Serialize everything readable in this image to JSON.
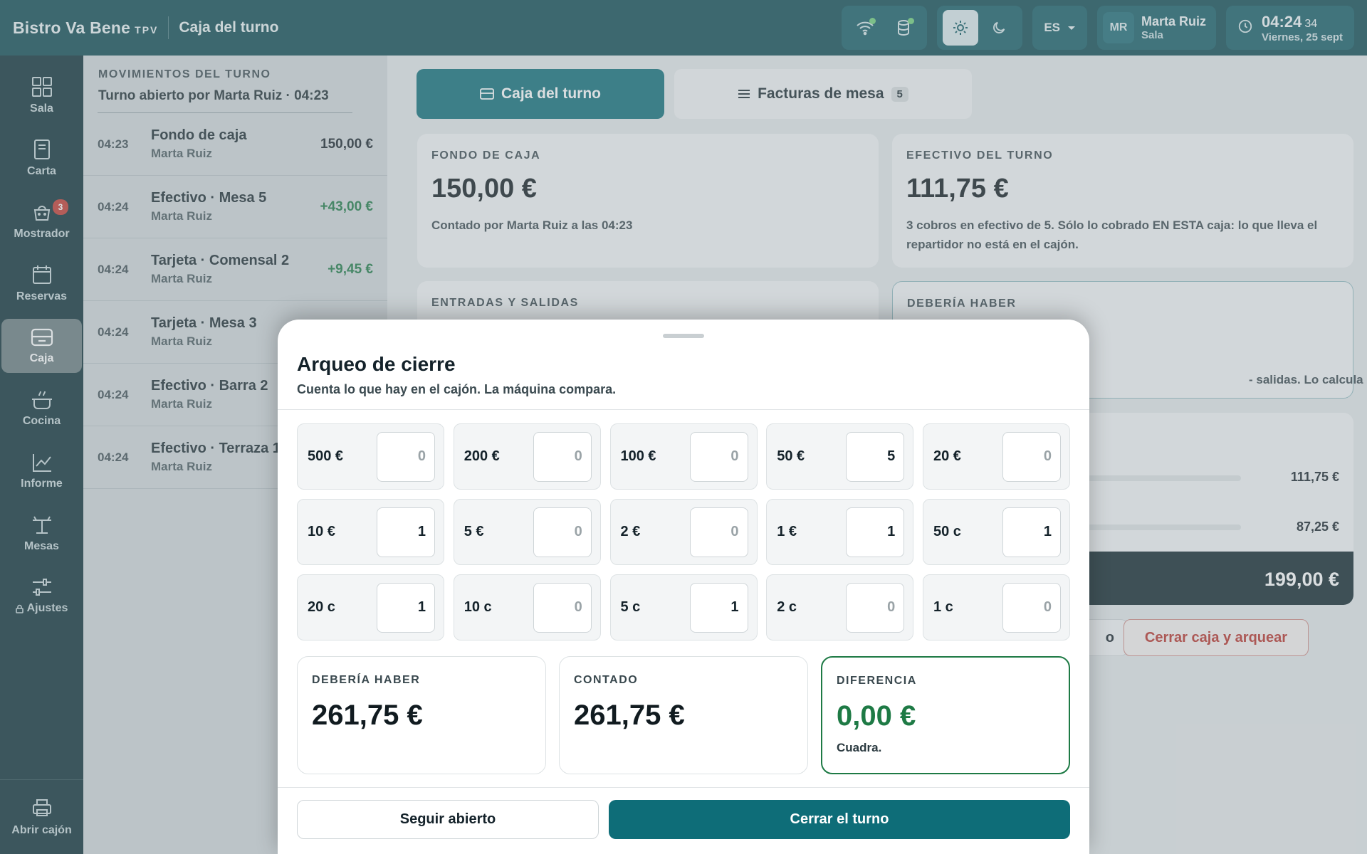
{
  "header": {
    "brand": "Bistro Va Bene",
    "brand_tag": "TPV",
    "screen_title": "Caja del turno",
    "lang": "ES",
    "user_initials": "MR",
    "user_name": "Marta Ruiz",
    "user_role": "Sala",
    "time": "04:24",
    "seconds": "34",
    "date": "Viernes, 25 sept",
    "icons": [
      "wifi-icon",
      "database-icon",
      "sun-icon",
      "moon-icon",
      "clock-icon"
    ],
    "status_color": "#6fd07a"
  },
  "sidebar": {
    "items": [
      {
        "label": "Sala",
        "icon": "grid-icon"
      },
      {
        "label": "Carta",
        "icon": "book-icon"
      },
      {
        "label": "Mostrador",
        "icon": "basket-icon",
        "badge": "3"
      },
      {
        "label": "Reservas",
        "icon": "calendar-icon"
      },
      {
        "label": "Caja",
        "icon": "register-icon",
        "active": true
      },
      {
        "label": "Cocina",
        "icon": "pot-icon"
      },
      {
        "label": "Informe",
        "icon": "chart-icon"
      },
      {
        "label": "Mesas",
        "icon": "table-icon"
      },
      {
        "label": "Ajustes",
        "icon": "sliders-icon",
        "locked": true
      }
    ],
    "drawer": "Abrir cajón"
  },
  "moves": {
    "title": "MOVIMIENTOS DEL TURNO",
    "subtitle": "Turno abierto por Marta Ruiz · 04:23",
    "rows": [
      {
        "time": "04:23",
        "label": "Fondo de caja",
        "who": "Marta Ruiz",
        "amount": "150,00 €"
      },
      {
        "time": "04:24",
        "label": "Efectivo · Mesa 5",
        "who": "Marta Ruiz",
        "amount": "+43,00 €"
      },
      {
        "time": "04:24",
        "label": "Tarjeta · Comensal 2",
        "who": "Marta Ruiz",
        "amount": "+9,45 €"
      },
      {
        "time": "04:24",
        "label": "Tarjeta · Mesa 3",
        "who": "Marta Ruiz",
        "amount": ""
      },
      {
        "time": "04:24",
        "label": "Efectivo · Barra 2",
        "who": "Marta Ruiz",
        "amount": ""
      },
      {
        "time": "04:24",
        "label": "Efectivo · Terraza 1",
        "who": "Marta Ruiz",
        "amount": ""
      }
    ]
  },
  "main": {
    "tabs": [
      {
        "label": "Caja del turno"
      },
      {
        "label": "Facturas de mesa",
        "count": "5"
      }
    ],
    "fondo": {
      "label": "FONDO DE CAJA",
      "value": "150,00 €",
      "text": "Contado por Marta Ruiz a las 04:23"
    },
    "efectivo": {
      "label": "EFECTIVO DEL TURNO",
      "value": "111,75 €",
      "text": "3 cobros en efectivo de 5. Sólo lo cobrado EN ESTA caja: lo que lleva el repartidor no está en el cajón."
    },
    "entradas": {
      "label": "ENTRADAS Y SALIDAS"
    },
    "deberia": {
      "label": "DEBERÍA HABER",
      "text_partial": "- salidas. Lo calcula la máquina."
    },
    "summary": {
      "row1": "111,75 €",
      "row2": "87,25 €",
      "total": "199,00 €"
    },
    "buttons": {
      "hidden_partial": "o",
      "close": "Cerrar caja y arquear"
    }
  },
  "modal": {
    "title": "Arqueo de cierre",
    "subtitle": "Cuenta lo que hay en el cajón. La máquina compara.",
    "denoms": [
      {
        "label": "500 €",
        "count": "0"
      },
      {
        "label": "200 €",
        "count": "0"
      },
      {
        "label": "100 €",
        "count": "0"
      },
      {
        "label": "50 €",
        "count": "5"
      },
      {
        "label": "20 €",
        "count": "0"
      },
      {
        "label": "10 €",
        "count": "1"
      },
      {
        "label": "5 €",
        "count": "0"
      },
      {
        "label": "2 €",
        "count": "0"
      },
      {
        "label": "1 €",
        "count": "1"
      },
      {
        "label": "50 c",
        "count": "1"
      },
      {
        "label": "20 c",
        "count": "1"
      },
      {
        "label": "10 c",
        "count": "0"
      },
      {
        "label": "5 c",
        "count": "1"
      },
      {
        "label": "2 c",
        "count": "0"
      },
      {
        "label": "1 c",
        "count": "0"
      }
    ],
    "totals": {
      "expected_label": "DEBERÍA HABER",
      "expected": "261,75 €",
      "counted_label": "CONTADO",
      "counted": "261,75 €",
      "diff_label": "DIFERENCIA",
      "diff": "0,00 €",
      "diff_note": "Cuadra."
    },
    "buttons": {
      "keep_open": "Seguir abierto",
      "close": "Cerrar el turno"
    }
  },
  "colors": {
    "accent": "#0e6d78",
    "positive": "#1e7a45",
    "danger": "#b8322a",
    "badge": "#c53a30"
  }
}
